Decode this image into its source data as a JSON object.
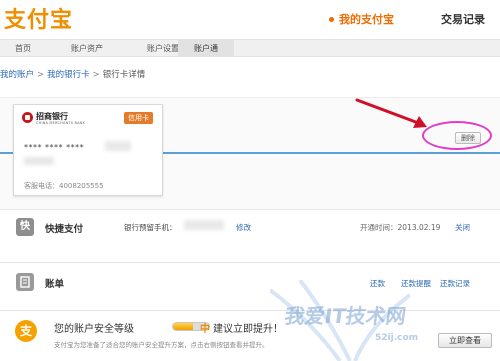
{
  "header": {
    "logo_text": "支付宝",
    "nav_my": "我的支付宝",
    "nav_trade": "交易记录"
  },
  "tabs": [
    {
      "label": "首页"
    },
    {
      "label": "账户资产"
    },
    {
      "label": "账户设置"
    },
    {
      "label": "账户通"
    }
  ],
  "breadcrumb": {
    "item1": "我的账户",
    "item2": "我的银行卡",
    "item3": "银行卡详情",
    "separator": ">"
  },
  "card": {
    "bank_name": "招商银行",
    "bank_sub": "CHINA MERCHANTS BANK",
    "type": "信用卡",
    "number": "**** **** ****",
    "service_phone": "客服电话：4008205555"
  },
  "delete_label": "删除",
  "quick_pay": {
    "icon_char": "快",
    "title": "快捷支付",
    "phone_label": "银行预留手机：",
    "modify_label": "修改",
    "open_time": "开通时间：2013.02.19",
    "close_label": "关闭"
  },
  "bill": {
    "title": "账单",
    "repay_label": "还款",
    "remind_label": "还款提醒",
    "record_label": "还款记录"
  },
  "security": {
    "icon_char": "支",
    "text": "您的账户安全等级",
    "level": "中",
    "level_fraction": 0.55,
    "advice": "建议立即提升！",
    "description": "支付宝为您准备了适合您的账户安全提升方案，点击右侧按钮查看并提升。",
    "button_label": "立即查看"
  },
  "watermark": {
    "main": "我爱IT技术网",
    "sub": "52ij.com"
  },
  "colors": {
    "brand_orange": "#f08d00",
    "link_blue": "#2d6ab4",
    "panel_blue_line": "#5a9fd6",
    "annotation_magenta": "#e33ac8",
    "annotation_arrow": "#d0102a"
  }
}
